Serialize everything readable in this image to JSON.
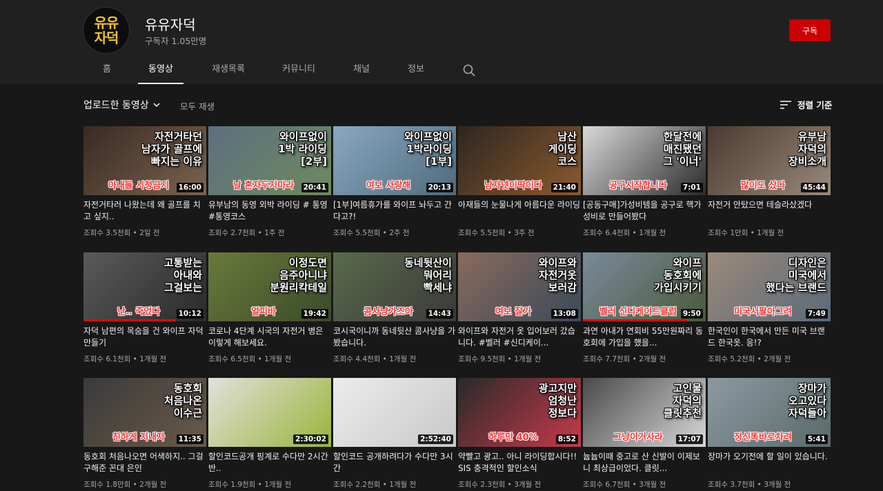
{
  "channel": {
    "avatar_text": [
      "유유",
      "자덕"
    ],
    "name": "유유자덕",
    "subscribers": "구독자 1.05만명",
    "subscribe_label": "구독"
  },
  "tabs": [
    {
      "label": "홈",
      "active": false
    },
    {
      "label": "동영상",
      "active": true
    },
    {
      "label": "재생목록",
      "active": false
    },
    {
      "label": "커뮤니티",
      "active": false
    },
    {
      "label": "채널",
      "active": false
    },
    {
      "label": "정보",
      "active": false
    }
  ],
  "toolbar": {
    "uploads_label": "업로드한 동영상",
    "play_all": "모두 재생",
    "sort_label": "정렬 기준"
  },
  "colors": {
    "accent": "#cc0000",
    "background": "#181818",
    "header_bg": "#202020",
    "thumb_overlay_red": "#ff3232"
  },
  "videos": [
    {
      "title": "자전거타러 나왔는데 왜 골프를 치고 싶지..",
      "views": "조회수 3.5천회",
      "age": "2일 전",
      "duration": "16:00",
      "thumb_text": "자전거타던\n남자가 골프에\n빠지는 이유",
      "thumb_red": "아내들 시청금지",
      "colors": [
        "#3a2a22",
        "#7a6450"
      ],
      "progress": 0
    },
    {
      "title": "유부남의 동영 외박 라이딩 # 통영 #통영코스",
      "views": "조회수 2.7천회",
      "age": "1주 전",
      "duration": "20:41",
      "thumb_text": "와이프없이\n1박 라이딩\n[2부]",
      "thumb_red": "날 혼자두지마라",
      "colors": [
        "#5d6f80",
        "#6d8a5c"
      ],
      "progress": 0
    },
    {
      "title": "[1부]여름휴가를 와이프 놔두고 간다고?!",
      "views": "조회수 5.5천회",
      "age": "2주 전",
      "duration": "20:13",
      "thumb_text": "와이프없이\n1박라이딩\n[1부]",
      "thumb_red": "여보 사랑해",
      "colors": [
        "#8aa7c2",
        "#4f6b7c"
      ],
      "progress": 0
    },
    {
      "title": "아재들의 눈물나게 아름다운 라이딩",
      "views": "조회수 5.5천회",
      "age": "3주 전",
      "duration": "21:40",
      "thumb_text": "남산\n게이딩\n코스",
      "thumb_red": "남자넷이딱이다",
      "colors": [
        "#2e2620",
        "#8c5a2e"
      ],
      "progress": 0
    },
    {
      "title": "[공동구매]가성비템을 공구로 핵가성비로 만들어봤다",
      "views": "조회수 6.4천회",
      "age": "1개월 전",
      "duration": "7:01",
      "thumb_text": "한달전에\n매진됐던\n그 '이너'",
      "thumb_red": "공구시작합니다",
      "colors": [
        "#d9d9d9",
        "#2a2a2a"
      ],
      "progress": 0
    },
    {
      "title": "자전거 안탔으면 테슬라샀겠다",
      "views": "조회수 1만회",
      "age": "1개월 전",
      "duration": "45:44",
      "thumb_text": "유부남\n자덕의\n장비소개",
      "thumb_red": "많이도 샀다",
      "colors": [
        "#4a3a30",
        "#9a8a7a"
      ],
      "progress": 0
    },
    {
      "title": "자덕 남편의 목숨을 건 와이프 자덕 만들기",
      "views": "조회수 6.1천회",
      "age": "1개월 전",
      "duration": "10:12",
      "thumb_text": "고통받는\n아내와\n그걸보는",
      "thumb_red": "난.. 죽었다",
      "colors": [
        "#5a5a5a",
        "#2a2a2a"
      ],
      "progress": 0.75
    },
    {
      "title": "코로나 4단계 시국의 자전거 병은 이렇게 해보세요.",
      "views": "조회수 6.5천회",
      "age": "1개월 전",
      "duration": "19:42",
      "thumb_text": "이정도면\n음주아니냐\n분원리칵테일",
      "thumb_red": "얼피바",
      "colors": [
        "#6a7a3a",
        "#3a4a2a"
      ],
      "progress": 0
    },
    {
      "title": "코시국이니까 동네뒷산 콤사냥을 가봤습니다.",
      "views": "조회수 4.4천회",
      "age": "1개월 전",
      "duration": "14:43",
      "thumb_text": "동네뒷산이\n뭐어리\n빡세냐",
      "thumb_red": "콤사냥가즈아",
      "colors": [
        "#5a6a4a",
        "#3a3a3a"
      ],
      "progress": 0
    },
    {
      "title": "와이프와 자전거 옷 입어보러 갔습니다. #벨러 #신디케이...",
      "views": "조회수 9.5천회",
      "age": "1개월 전",
      "duration": "13:08",
      "thumb_text": "와이프와\n자전거옷\n보러감",
      "thumb_red": "여보 잘가",
      "colors": [
        "#8a6a5a",
        "#3a4a5a"
      ],
      "progress": 0
    },
    {
      "title": "과연 아내가 연회비 55만원짜리 동호회에 가입을 했을...",
      "views": "조회수 7.7천회",
      "age": "2개월 전",
      "duration": "9:50",
      "thumb_text": "와이프\n동호회에\n가입시키기",
      "thumb_red": "벨러 신디케이트클럽",
      "colors": [
        "#7a8a9a",
        "#4a5a3a"
      ],
      "progress": 0.85
    },
    {
      "title": "한국인이 한국에서 만든 미국 브랜드 한국옷. 응!?",
      "views": "조회수 5.2천회",
      "age": "2개월 전",
      "duration": "7:49",
      "thumb_text": "디자인은\n미국에서\n했다는 브랜드",
      "thumb_red": "미국서팔아그려",
      "colors": [
        "#9a8a7a",
        "#5a6a7a"
      ],
      "progress": 0
    },
    {
      "title": "동호회 처음나오면 어색하지.. 그걸 구해준 꼰대 은인",
      "views": "조회수 1.8만회",
      "age": "2개월 전",
      "duration": "11:35",
      "thumb_text": "동호회\n처음나온\n이수근",
      "thumb_red": "친하게 지내자",
      "colors": [
        "#3a3a3a",
        "#6a5a4a"
      ],
      "progress": 0
    },
    {
      "title": "할인코드공개 핑계로 수다만 2시간반..",
      "views": "조회수 1.9천회",
      "age": "1개월 전",
      "duration": "2:30:02",
      "thumb_text": "",
      "thumb_red": "",
      "colors": [
        "#e2e0dc",
        "#9ab43a"
      ],
      "progress": 0
    },
    {
      "title": "할인코드 공개하려다가 수다만 3시간",
      "views": "조회수 2.2천회",
      "age": "1개월 전",
      "duration": "2:52:40",
      "thumb_text": "",
      "thumb_red": "",
      "colors": [
        "#ececec",
        "#c8c8c8"
      ],
      "progress": 0
    },
    {
      "title": "약빨고 광고.. 아니 라이딩합시다!! SIS 충격적인 할인소식",
      "views": "조회수 2.3천회",
      "age": "3개월 전",
      "duration": "8:52",
      "thumb_text": "광고지만\n엄청난\n정보다",
      "thumb_red": "하루만 40%",
      "colors": [
        "#2a2a2a",
        "#c83a4a"
      ],
      "progress": 0
    },
    {
      "title": "늅늅이때 중고로 산 신발이 이제보니 최상급이었다. 클릿...",
      "views": "조회수 6.7천회",
      "age": "3개월 전",
      "duration": "17:07",
      "thumb_text": "고인물\n자덕의\n클릿추천",
      "thumb_red": "그냥이거사라",
      "colors": [
        "#4a4a4a",
        "#d8d8d8"
      ],
      "progress": 0
    },
    {
      "title": "장마가 오기전에 할 일이 있습니다.",
      "views": "조회수 3.7천회",
      "age": "3개월 전",
      "duration": "5:41",
      "thumb_text": "장마가\n오고있다\n자덕들아",
      "thumb_red": "정신똑바로차려",
      "colors": [
        "#8a9aa0",
        "#5a6a6a"
      ],
      "progress": 0
    }
  ]
}
